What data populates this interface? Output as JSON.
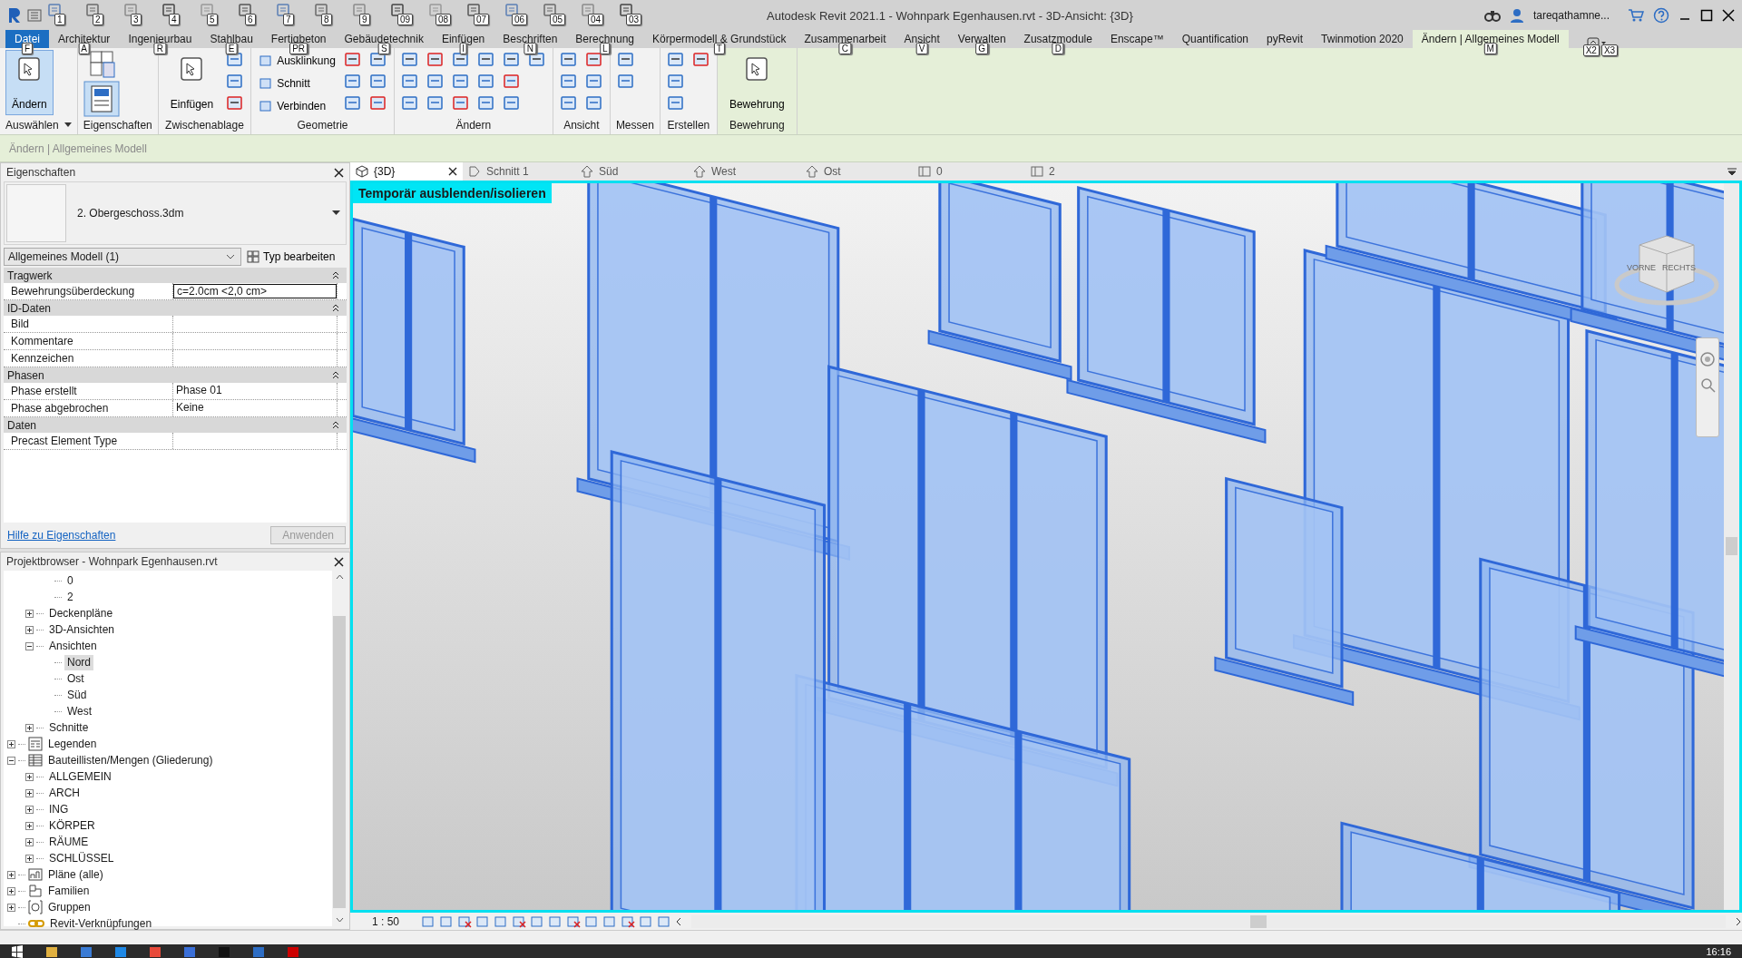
{
  "window": {
    "title": "Autodesk Revit 2021.1 - Wohnpark Egenhausen.rvt - 3D-Ansicht: {3D}",
    "user": "tareqathamne..."
  },
  "quick_access": [
    {
      "keytip": "1"
    },
    {
      "keytip": "2"
    },
    {
      "keytip": "3"
    },
    {
      "keytip": "4"
    },
    {
      "keytip": "5"
    },
    {
      "keytip": "6"
    },
    {
      "keytip": "7"
    },
    {
      "keytip": "8"
    },
    {
      "keytip": "9"
    },
    {
      "keytip": "09"
    },
    {
      "keytip": "08"
    },
    {
      "keytip": "07"
    },
    {
      "keytip": "06"
    },
    {
      "keytip": "05"
    },
    {
      "keytip": "04"
    },
    {
      "keytip": "03"
    }
  ],
  "ribbon_tabs": [
    {
      "label": "Datei",
      "kind": "file",
      "selected": false,
      "keytip": "F"
    },
    {
      "label": "Architektur",
      "kind": "tab",
      "selected": false,
      "keytip": "A"
    },
    {
      "label": "Ingenieurbau",
      "kind": "tab",
      "selected": false,
      "keytip": "R"
    },
    {
      "label": "Stahlbau",
      "kind": "tab",
      "selected": false,
      "keytip": "E"
    },
    {
      "label": "Fertigbeton",
      "kind": "tab",
      "selected": false,
      "keytip": "PR"
    },
    {
      "label": "Gebäudetechnik",
      "kind": "tab",
      "selected": false,
      "keytip": "S"
    },
    {
      "label": "Einfügen",
      "kind": "tab",
      "selected": false,
      "keytip": "I"
    },
    {
      "label": "Beschriften",
      "kind": "tab",
      "selected": false,
      "keytip": "N"
    },
    {
      "label": "Berechnung",
      "kind": "tab",
      "selected": false,
      "keytip": "L"
    },
    {
      "label": "Körpermodell & Grundstück",
      "kind": "tab",
      "selected": false,
      "keytip": "T"
    },
    {
      "label": "Zusammenarbeit",
      "kind": "tab",
      "selected": false,
      "keytip": "C"
    },
    {
      "label": "Ansicht",
      "kind": "tab",
      "selected": false,
      "keytip": "V"
    },
    {
      "label": "Verwalten",
      "kind": "tab",
      "selected": false,
      "keytip": "G"
    },
    {
      "label": "Zusatzmodule",
      "kind": "tab",
      "selected": false,
      "keytip": "D"
    },
    {
      "label": "Enscape™",
      "kind": "tab",
      "selected": false
    },
    {
      "label": "Quantification",
      "kind": "tab",
      "selected": false
    },
    {
      "label": "pyRevit",
      "kind": "tab",
      "selected": false
    },
    {
      "label": "Twinmotion 2020",
      "kind": "tab",
      "selected": false
    },
    {
      "label": "Ändern | Allgemeines Modell",
      "kind": "context",
      "selected": true,
      "keytip": "M"
    }
  ],
  "ribbon_toggle_keytips": [
    "X2",
    "X3"
  ],
  "ribbon_panels": [
    {
      "label": "Auswählen",
      "dropdown": true,
      "contextual": false,
      "tools": [
        {
          "kind": "large",
          "label": "Ändern",
          "selected": true
        }
      ]
    },
    {
      "label": "Eigenschaften",
      "dropdown": false,
      "contextual": false,
      "tools": [
        {
          "kind": "stack"
        }
      ]
    },
    {
      "label": "Zwischenablage",
      "dropdown": false,
      "contextual": false,
      "tools": [
        {
          "kind": "large",
          "label": "Einfügen",
          "selected": false
        },
        {
          "kind": "icon"
        },
        {
          "kind": "icon"
        },
        {
          "kind": "icon"
        }
      ]
    },
    {
      "label": "Geometrie",
      "dropdown": false,
      "contextual": false,
      "tools": [
        {
          "kind": "small",
          "label": "Ausklinkung"
        },
        {
          "kind": "small",
          "label": "Schnitt"
        },
        {
          "kind": "small",
          "label": "Verbinden"
        },
        {
          "kind": "icon"
        },
        {
          "kind": "icon"
        },
        {
          "kind": "icon"
        },
        {
          "kind": "icon"
        },
        {
          "kind": "icon"
        },
        {
          "kind": "icon"
        }
      ]
    },
    {
      "label": "Ändern",
      "dropdown": false,
      "contextual": false,
      "tools": [
        {
          "kind": "icon"
        },
        {
          "kind": "icon"
        },
        {
          "kind": "icon"
        },
        {
          "kind": "icon"
        },
        {
          "kind": "icon"
        },
        {
          "kind": "icon"
        },
        {
          "kind": "icon"
        },
        {
          "kind": "icon"
        },
        {
          "kind": "icon"
        },
        {
          "kind": "icon"
        },
        {
          "kind": "icon"
        },
        {
          "kind": "icon"
        },
        {
          "kind": "icon"
        },
        {
          "kind": "icon"
        },
        {
          "kind": "icon"
        },
        {
          "kind": "icon"
        }
      ]
    },
    {
      "label": "Ansicht",
      "dropdown": false,
      "contextual": false,
      "tools": [
        {
          "kind": "icon"
        },
        {
          "kind": "icon"
        },
        {
          "kind": "icon"
        },
        {
          "kind": "icon"
        },
        {
          "kind": "icon"
        },
        {
          "kind": "icon"
        }
      ]
    },
    {
      "label": "Messen",
      "dropdown": false,
      "contextual": false,
      "tools": [
        {
          "kind": "icon"
        },
        {
          "kind": "icon"
        }
      ]
    },
    {
      "label": "Erstellen",
      "dropdown": false,
      "contextual": false,
      "tools": [
        {
          "kind": "icon"
        },
        {
          "kind": "icon"
        },
        {
          "kind": "icon"
        },
        {
          "kind": "icon"
        }
      ]
    },
    {
      "label": "Bewehrung",
      "dropdown": false,
      "contextual": true,
      "tools": [
        {
          "kind": "large",
          "label": "Bewehrung",
          "selected": false
        }
      ]
    }
  ],
  "context_bar": "Ändern | Allgemeines Modell",
  "properties": {
    "title": "Eigenschaften",
    "type_name": "2. Obergeschoss.3dm",
    "filter": "Allgemeines Modell (1)",
    "edit_type": "Typ bearbeiten",
    "groups": [
      {
        "name": "Tragwerk",
        "rows": [
          {
            "name": "Bewehrungsüberdeckung",
            "value": "c=2.0cm <2,0 cm>",
            "editing": true
          }
        ]
      },
      {
        "name": "ID-Daten",
        "rows": [
          {
            "name": "Bild",
            "editing": false
          },
          {
            "name": "Kommentare",
            "editing": false
          },
          {
            "name": "Kennzeichen",
            "editing": false
          }
        ]
      },
      {
        "name": "Phasen",
        "rows": [
          {
            "name": "Phase erstellt",
            "value": "Phase 01",
            "editing": false
          },
          {
            "name": "Phase abgebrochen",
            "value": "Keine",
            "editing": false
          }
        ]
      },
      {
        "name": "Daten",
        "rows": [
          {
            "name": "Precast Element Type",
            "editing": false
          }
        ]
      }
    ],
    "help_link": "Hilfe zu Eigenschaften",
    "apply": {
      "label": "Anwenden",
      "disabled": true
    }
  },
  "browser": {
    "title": "Projektbrowser - Wohnpark Egenhausen.rvt",
    "tree": [
      {
        "children": [
          {
            "children": [
              {
                "label": "0",
                "selected": false
              },
              {
                "label": "2",
                "selected": false
              }
            ]
          },
          {
            "label": "Deckenpläne",
            "expanded": false,
            "selected": false
          },
          {
            "label": "3D-Ansichten",
            "expanded": false,
            "selected": false
          },
          {
            "label": "Ansichten",
            "expanded": true,
            "selected": false,
            "children": [
              {
                "label": "Nord",
                "selected": true
              },
              {
                "label": "Ost",
                "selected": false
              },
              {
                "label": "Süd",
                "selected": false
              },
              {
                "label": "West",
                "selected": false
              }
            ]
          },
          {
            "label": "Schnitte",
            "expanded": false,
            "selected": false
          }
        ]
      },
      {
        "label": "Legenden",
        "kind": "legend",
        "expanded": false,
        "selected": false
      },
      {
        "label": "Bauteillisten/Mengen (Gliederung)",
        "kind": "schedule",
        "expanded": true,
        "selected": false,
        "children": [
          {
            "label": "ALLGEMEIN",
            "expanded": false,
            "selected": false
          },
          {
            "label": "ARCH",
            "expanded": false,
            "selected": false
          },
          {
            "label": "ING",
            "expanded": false,
            "selected": false
          },
          {
            "label": "KÖRPER",
            "expanded": false,
            "selected": false
          },
          {
            "label": "RÄUME",
            "expanded": false,
            "selected": false
          },
          {
            "label": "SCHLÜSSEL",
            "expanded": false,
            "selected": false
          }
        ]
      },
      {
        "label": "Pläne (alle)",
        "kind": "sheet",
        "expanded": false,
        "selected": false
      },
      {
        "label": "Familien",
        "kind": "family",
        "expanded": false,
        "selected": false
      },
      {
        "label": "Gruppen",
        "kind": "group",
        "expanded": false,
        "selected": false
      },
      {
        "label": "Revit-Verknüpfungen",
        "kind": "link",
        "selected": false
      }
    ]
  },
  "view_tabs": [
    {
      "label": "{3D}",
      "kind": "perspective",
      "selected": true
    },
    {
      "label": "Schnitt 1",
      "kind": "section",
      "selected": false
    },
    {
      "label": "Süd",
      "kind": "elevation",
      "selected": false
    },
    {
      "label": "West",
      "kind": "elevation",
      "selected": false
    },
    {
      "label": "Ost",
      "kind": "elevation",
      "selected": false
    },
    {
      "label": "0",
      "kind": "plan",
      "selected": false
    },
    {
      "label": "2",
      "kind": "plan",
      "selected": false
    }
  ],
  "viewport": {
    "banner": "Temporär ausblenden/isolieren",
    "viewcube": {
      "front": "VORNE",
      "right": "RECHTS"
    }
  },
  "view_control": {
    "scale": "1 : 50"
  },
  "taskbar": {
    "time": "16:16"
  }
}
